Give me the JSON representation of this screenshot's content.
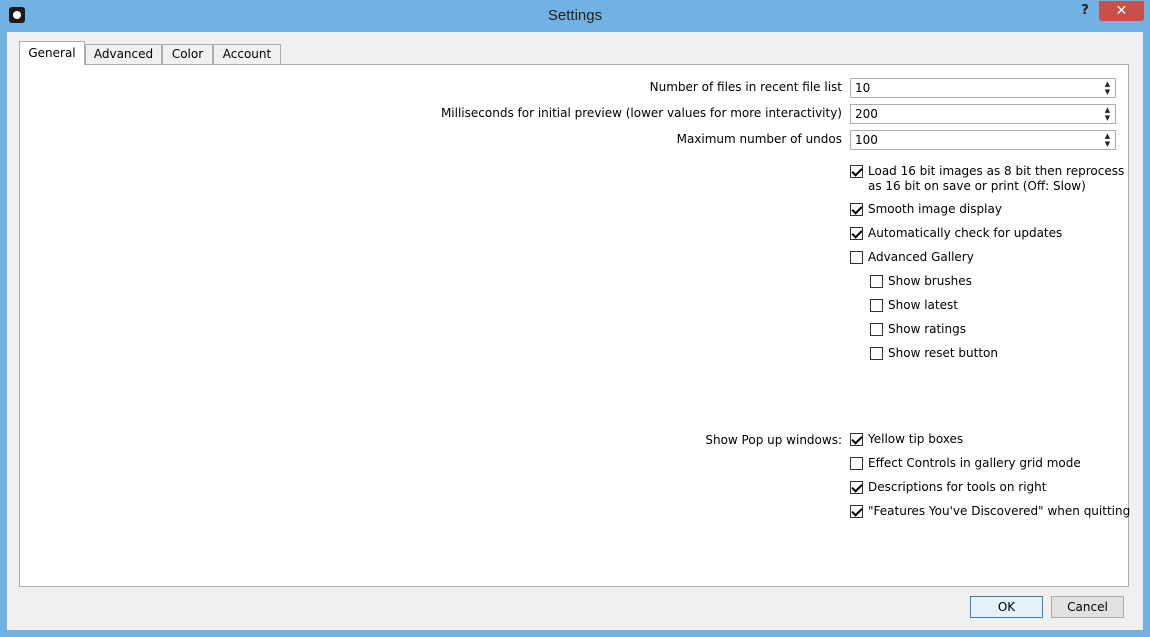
{
  "window": {
    "title": "Settings",
    "help": "?",
    "close": "✕"
  },
  "tabs": [
    {
      "label": "General",
      "active": true
    },
    {
      "label": "Advanced"
    },
    {
      "label": "Color"
    },
    {
      "label": "Account"
    }
  ],
  "general": {
    "spinners": [
      {
        "label": "Number of files in recent file list",
        "value": "10"
      },
      {
        "label": "Milliseconds for initial preview (lower values for more interactivity)",
        "value": "200"
      },
      {
        "label": "Maximum number of undos",
        "value": "100"
      }
    ],
    "checkboxes": [
      {
        "label_line1": "Load 16 bit images as 8 bit then reprocess",
        "label_line2": "as 16 bit on save or print (Off: Slow)",
        "checked": true
      },
      {
        "label": "Smooth image display",
        "checked": true
      },
      {
        "label": "Automatically check for updates",
        "checked": true
      },
      {
        "label": "Advanced Gallery",
        "checked": false
      },
      {
        "label": "Show brushes",
        "checked": false
      },
      {
        "label": "Show latest",
        "checked": false
      },
      {
        "label": "Show ratings",
        "checked": false
      },
      {
        "label": "Show reset button",
        "checked": false
      }
    ],
    "popups_label": "Show Pop up windows:",
    "popups": [
      {
        "label": "Yellow tip boxes",
        "checked": true
      },
      {
        "label": "Effect Controls in gallery grid mode",
        "checked": false
      },
      {
        "label": "Descriptions for tools on right",
        "checked": true
      },
      {
        "label": "\"Features You've Discovered\" when quitting",
        "checked": true
      }
    ]
  },
  "buttons": {
    "ok": "OK",
    "cancel": "Cancel"
  }
}
